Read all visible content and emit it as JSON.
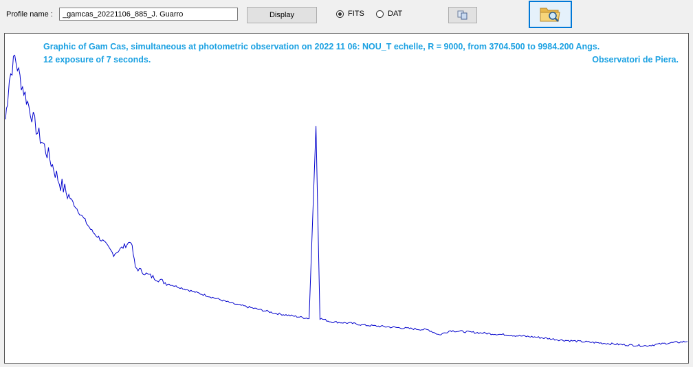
{
  "toolbar": {
    "profile_label": "Profile name :",
    "profile_value": "_gamcas_20221106_885_J. Guarro",
    "display_label": "Display",
    "fits_label": "FITS",
    "dat_label": "DAT",
    "fits_selected": true,
    "dat_selected": false,
    "copy_icon": "copy-icon",
    "open_icon": "folder-search-icon"
  },
  "plot": {
    "title_line1": "Graphic of Gam Cas, simultaneous at photometric observation on 2022 11 06: NOU_T echelle, R = 9000, from 3704.500 to 9984.200 Angs.",
    "title_line2": "12 exposure of 7 seconds.",
    "title_line3": "Observatori de Piera.",
    "line_color": "#0000cc",
    "title_color": "#1ba1e2"
  },
  "chart_data": {
    "type": "line",
    "title": "Graphic of Gam Cas, simultaneous at photometric observation on 2022 11 06: NOU_T echelle, R = 9000, from 3704.500 to 9984.200 Angs.",
    "xlim": [
      3704.5,
      9984.2
    ],
    "series": [
      {
        "x": [
          3704.5,
          3740,
          3790,
          3850,
          3920,
          4000,
          4100,
          4200,
          4300,
          4400,
          4500,
          4600,
          4700,
          4861,
          4900,
          5000,
          5200,
          5400,
          5600,
          5800,
          6000,
          6200,
          6400,
          6500,
          6563,
          6600,
          6700,
          6900,
          7000,
          7200,
          7400,
          7600,
          7700,
          7800,
          8000,
          8200,
          8400,
          8600,
          8800,
          9000,
          9200,
          9400,
          9600,
          9800,
          9984.2
        ],
        "y": [
          0.74,
          0.86,
          0.93,
          0.85,
          0.78,
          0.7,
          0.63,
          0.55,
          0.5,
          0.45,
          0.4,
          0.37,
          0.33,
          0.37,
          0.29,
          0.27,
          0.24,
          0.22,
          0.2,
          0.18,
          0.165,
          0.15,
          0.14,
          0.135,
          0.72,
          0.135,
          0.125,
          0.12,
          0.115,
          0.11,
          0.105,
          0.1,
          0.085,
          0.098,
          0.093,
          0.088,
          0.083,
          0.078,
          0.07,
          0.065,
          0.06,
          0.055,
          0.052,
          0.06,
          0.065
        ]
      }
    ]
  }
}
